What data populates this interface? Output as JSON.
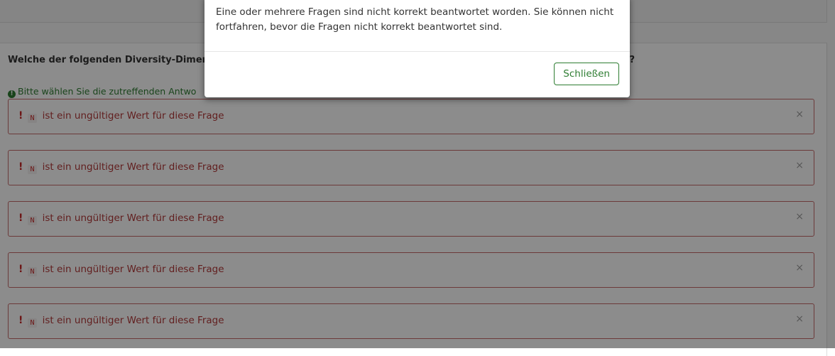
{
  "question": {
    "title": "Welche der folgenden Diversity-Dimensi",
    "title_tail": "?",
    "hint": "Bitte wählen Sie die zutreffenden Antwo"
  },
  "errors": [
    {
      "bang": "!",
      "code": "N",
      "text": "ist ein ungültiger Wert für diese Frage",
      "close": "×"
    },
    {
      "bang": "!",
      "code": "N",
      "text": "ist ein ungültiger Wert für diese Frage",
      "close": "×"
    },
    {
      "bang": "!",
      "code": "N",
      "text": "ist ein ungültiger Wert für diese Frage",
      "close": "×"
    },
    {
      "bang": "!",
      "code": "N",
      "text": "ist ein ungültiger Wert für diese Frage",
      "close": "×"
    },
    {
      "bang": "!",
      "code": "N",
      "text": "ist ein ungültiger Wert für diese Frage",
      "close": "×"
    }
  ],
  "modal": {
    "message_line1": "Eine oder mehrere Fragen sind nicht korrekt beantwortet worden. Sie können nicht",
    "message_line2": "fortfahren, bevor die Fragen nicht korrekt beantwortet sind.",
    "close_label": "Schließen"
  },
  "colors": {
    "success": "#2e7d32",
    "error_border": "#c56b6b",
    "error_text": "#b23a3a"
  }
}
